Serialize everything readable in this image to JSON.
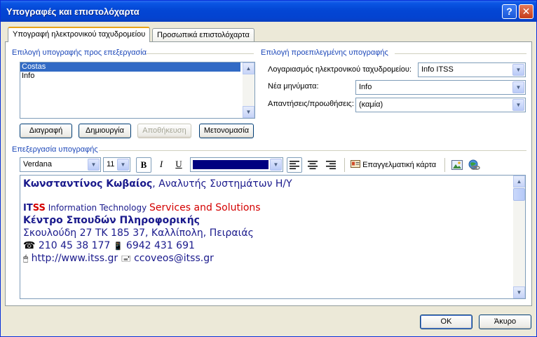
{
  "window": {
    "title": "Υπογραφές και επιστολόχαρτα",
    "help_glyph": "?",
    "close_glyph": "✕"
  },
  "tabs": [
    {
      "label": "Υπογραφή ηλεκτρονικού ταχυδρομείου",
      "active": true
    },
    {
      "label": "Προσωπικά επιστολόχαρτα",
      "active": false
    }
  ],
  "select_signature": {
    "label": "Επιλογή υπογραφής προς επεξεργασία",
    "items": [
      "Costas",
      "Info"
    ],
    "selected": "Costas"
  },
  "actions": {
    "delete": "Διαγραφή",
    "create": "Δημιουργία",
    "save": "Αποθήκευση",
    "rename": "Μετονομασία"
  },
  "default_signature": {
    "label": "Επιλογή προεπιλεγμένης υπογραφής",
    "account_label": "Λογαριασμός ηλεκτρονικού ταχυδρομείου:",
    "account_value": "Info ITSS",
    "new_messages_label": "Νέα μηνύματα:",
    "new_messages_value": "Info",
    "replies_label": "Απαντήσεις/προωθήσεις:",
    "replies_value": "(καμία)"
  },
  "edit_signature": {
    "label": "Επεξεργασία υπογραφής",
    "font": "Verdana",
    "size": "11",
    "bold": "B",
    "italic": "I",
    "underline": "U",
    "font_color": "#000080",
    "business_card_label": "Επαγγελματική κάρτα"
  },
  "signature": {
    "name": "Κωνσταντίνος Κωβαίος",
    "role": ", Αναλυτής Συστημάτων Η/Υ",
    "logo_it": "IT",
    "logo_ss": "SS",
    "company_tech": " Information Technology ",
    "company_services": "Services and Solutions",
    "center": "Κέντρο Σπουδών Πληροφορικής",
    "address": "Σκουλούδη 27 ΤΚ 185 37, Καλλίπολη, Πειραιάς",
    "phone_icon": "☎",
    "phone": " 210 45 38 177 ",
    "mobile_icon": "📱",
    "mobile": " 6942 431 691",
    "web_icon": "🖱",
    "website": " http://www.itss.gr ",
    "email_icon": "🖃",
    "email": " ccoveos@itss.gr"
  },
  "footer": {
    "ok": "OK",
    "cancel": "Άκυρο"
  },
  "colors": {
    "titlebar": "#0346d4",
    "selection": "#316ac5",
    "group_label": "#1c47b8",
    "signature_text": "#1a1a8c",
    "logo_red": "#d40000"
  }
}
